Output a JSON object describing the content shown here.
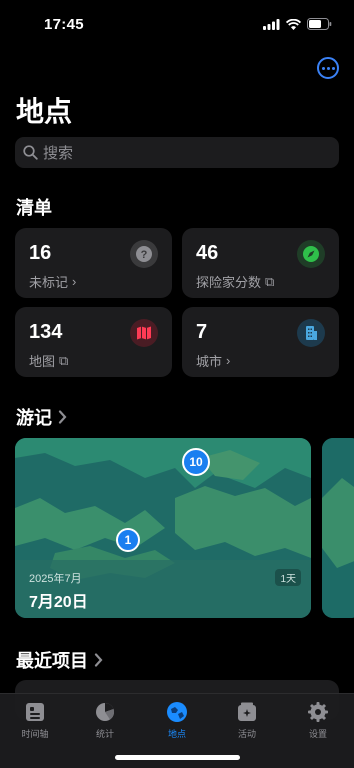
{
  "status_bar": {
    "time": "17:45"
  },
  "header": {
    "title": "地点",
    "more_icon": "ellipsis-circle-icon"
  },
  "search": {
    "placeholder": "搜索"
  },
  "sections": {
    "list_title": "清单",
    "trips_title": "游记",
    "recent_title": "最近项目"
  },
  "list_cards": [
    {
      "value": "16",
      "label": "未标记",
      "suffix": "›",
      "icon": "question-icon",
      "color": "#8e8e93"
    },
    {
      "value": "46",
      "label": "探险家分数",
      "suffix": "⧉",
      "icon": "compass-icon",
      "color": "#2fbf4a"
    },
    {
      "value": "134",
      "label": "地图",
      "suffix": "⧉",
      "icon": "map-icon",
      "color": "#ff3b55"
    },
    {
      "value": "7",
      "label": "城市",
      "suffix": "›",
      "icon": "building-icon",
      "color": "#4aa8e0"
    }
  ],
  "trip": {
    "date": "2025年7月",
    "title": "7月20日",
    "days": "1天",
    "pins": [
      "10",
      "1"
    ]
  },
  "tabs": [
    {
      "label": "时间轴",
      "icon": "timeline-icon"
    },
    {
      "label": "统计",
      "icon": "pie-chart-icon"
    },
    {
      "label": "地点",
      "icon": "globe-icon"
    },
    {
      "label": "活动",
      "icon": "activity-icon"
    },
    {
      "label": "设置",
      "icon": "gear-icon"
    }
  ],
  "colors": {
    "accent": "#1a8cff",
    "background": "#000000",
    "card": "#1c1c1e"
  }
}
